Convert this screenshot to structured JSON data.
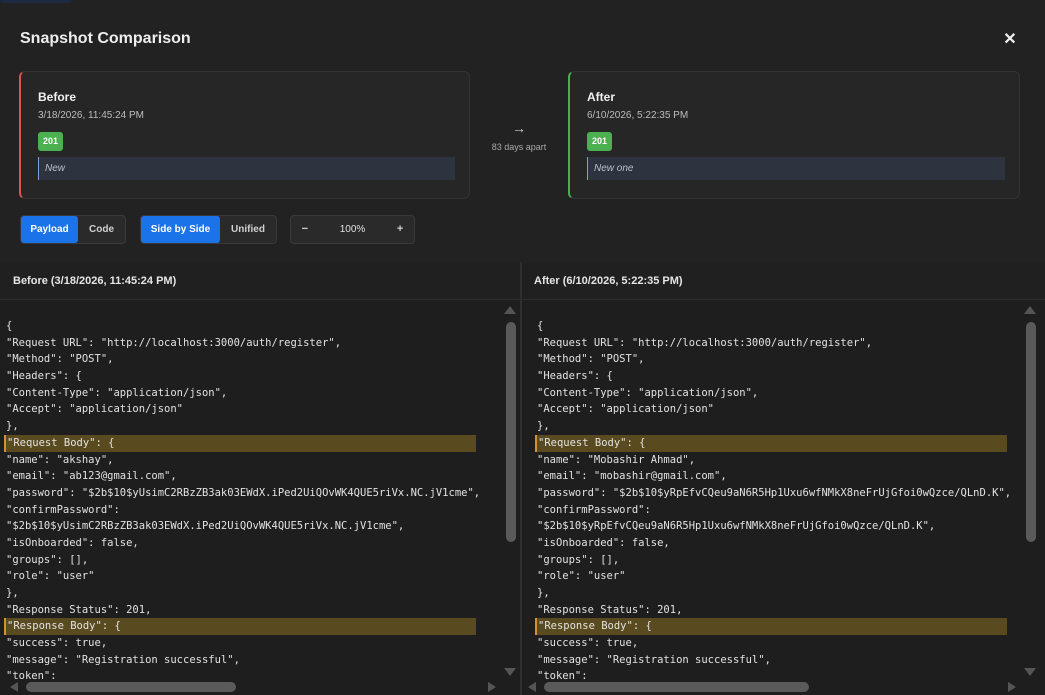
{
  "modal": {
    "title": "Snapshot Comparison",
    "close_label": "✕"
  },
  "before": {
    "title": "Before",
    "date": "3/18/2026, 11:45:24 PM",
    "status": "201",
    "description": "New",
    "accent": "#d9534f"
  },
  "after": {
    "title": "After",
    "date": "6/10/2026, 5:22:35 PM",
    "status": "201",
    "description": "New one",
    "accent": "#4caf50"
  },
  "gap": {
    "arrow": "→",
    "label": "83 days apart"
  },
  "toolbar": {
    "view_payload": "Payload",
    "view_code": "Code",
    "mode_side": "Side by Side",
    "mode_unified": "Unified",
    "zoom_out": "−",
    "zoom_value": "100%",
    "zoom_in": "+"
  },
  "left_pane": {
    "header": "Before (3/18/2026, 11:45:24 PM)",
    "lines": [
      {
        "text": "{",
        "hl": false
      },
      {
        "text": "\"Request URL\": \"http://localhost:3000/auth/register\",",
        "hl": false
      },
      {
        "text": "\"Method\": \"POST\",",
        "hl": false
      },
      {
        "text": "\"Headers\": {",
        "hl": false
      },
      {
        "text": "\"Content-Type\": \"application/json\",",
        "hl": false
      },
      {
        "text": "\"Accept\": \"application/json\"",
        "hl": false
      },
      {
        "text": "},",
        "hl": false
      },
      {
        "text": "\"Request Body\": {",
        "hl": true
      },
      {
        "text": "\"name\": \"akshay\",",
        "hl": false
      },
      {
        "text": "\"email\": \"ab123@gmail.com\",",
        "hl": false
      },
      {
        "text": "\"password\": \"$2b$10$yUsimC2RBzZB3ak03EWdX.iPed2UiQOvWK4QUE5riVx.NC.jV1cme\",",
        "hl": false
      },
      {
        "text": "\"confirmPassword\":",
        "hl": false
      },
      {
        "text": "\"$2b$10$yUsimC2RBzZB3ak03EWdX.iPed2UiQOvWK4QUE5riVx.NC.jV1cme\",",
        "hl": false
      },
      {
        "text": "\"isOnboarded\": false,",
        "hl": false
      },
      {
        "text": "\"groups\": [],",
        "hl": false
      },
      {
        "text": "\"role\": \"user\"",
        "hl": false
      },
      {
        "text": "},",
        "hl": false
      },
      {
        "text": "\"Response Status\": 201,",
        "hl": false
      },
      {
        "text": "\"Response Body\": {",
        "hl": true
      },
      {
        "text": "\"success\": true,",
        "hl": false
      },
      {
        "text": "\"message\": \"Registration successful\",",
        "hl": false
      },
      {
        "text": "\"token\":",
        "hl": false
      }
    ]
  },
  "right_pane": {
    "header": "After (6/10/2026, 5:22:35 PM)",
    "lines": [
      {
        "text": "{",
        "hl": false
      },
      {
        "text": "\"Request URL\": \"http://localhost:3000/auth/register\",",
        "hl": false
      },
      {
        "text": "\"Method\": \"POST\",",
        "hl": false
      },
      {
        "text": "\"Headers\": {",
        "hl": false
      },
      {
        "text": "\"Content-Type\": \"application/json\",",
        "hl": false
      },
      {
        "text": "\"Accept\": \"application/json\"",
        "hl": false
      },
      {
        "text": "},",
        "hl": false
      },
      {
        "text": "\"Request Body\": {",
        "hl": true
      },
      {
        "text": "\"name\": \"Mobashir Ahmad\",",
        "hl": false
      },
      {
        "text": "\"email\": \"mobashir@gmail.com\",",
        "hl": false
      },
      {
        "text": "\"password\": \"$2b$10$yRpEfvCQeu9aN6R5Hp1Uxu6wfNMkX8neFrUjGfoi0wQzce/QLnD.K\",",
        "hl": false
      },
      {
        "text": "\"confirmPassword\":",
        "hl": false
      },
      {
        "text": "\"$2b$10$yRpEfvCQeu9aN6R5Hp1Uxu6wfNMkX8neFrUjGfoi0wQzce/QLnD.K\",",
        "hl": false
      },
      {
        "text": "\"isOnboarded\": false,",
        "hl": false
      },
      {
        "text": "\"groups\": [],",
        "hl": false
      },
      {
        "text": "\"role\": \"user\"",
        "hl": false
      },
      {
        "text": "},",
        "hl": false
      },
      {
        "text": "\"Response Status\": 201,",
        "hl": false
      },
      {
        "text": "\"Response Body\": {",
        "hl": true
      },
      {
        "text": "\"success\": true,",
        "hl": false
      },
      {
        "text": "\"message\": \"Registration successful\",",
        "hl": false
      },
      {
        "text": "\"token\":",
        "hl": false
      }
    ]
  }
}
